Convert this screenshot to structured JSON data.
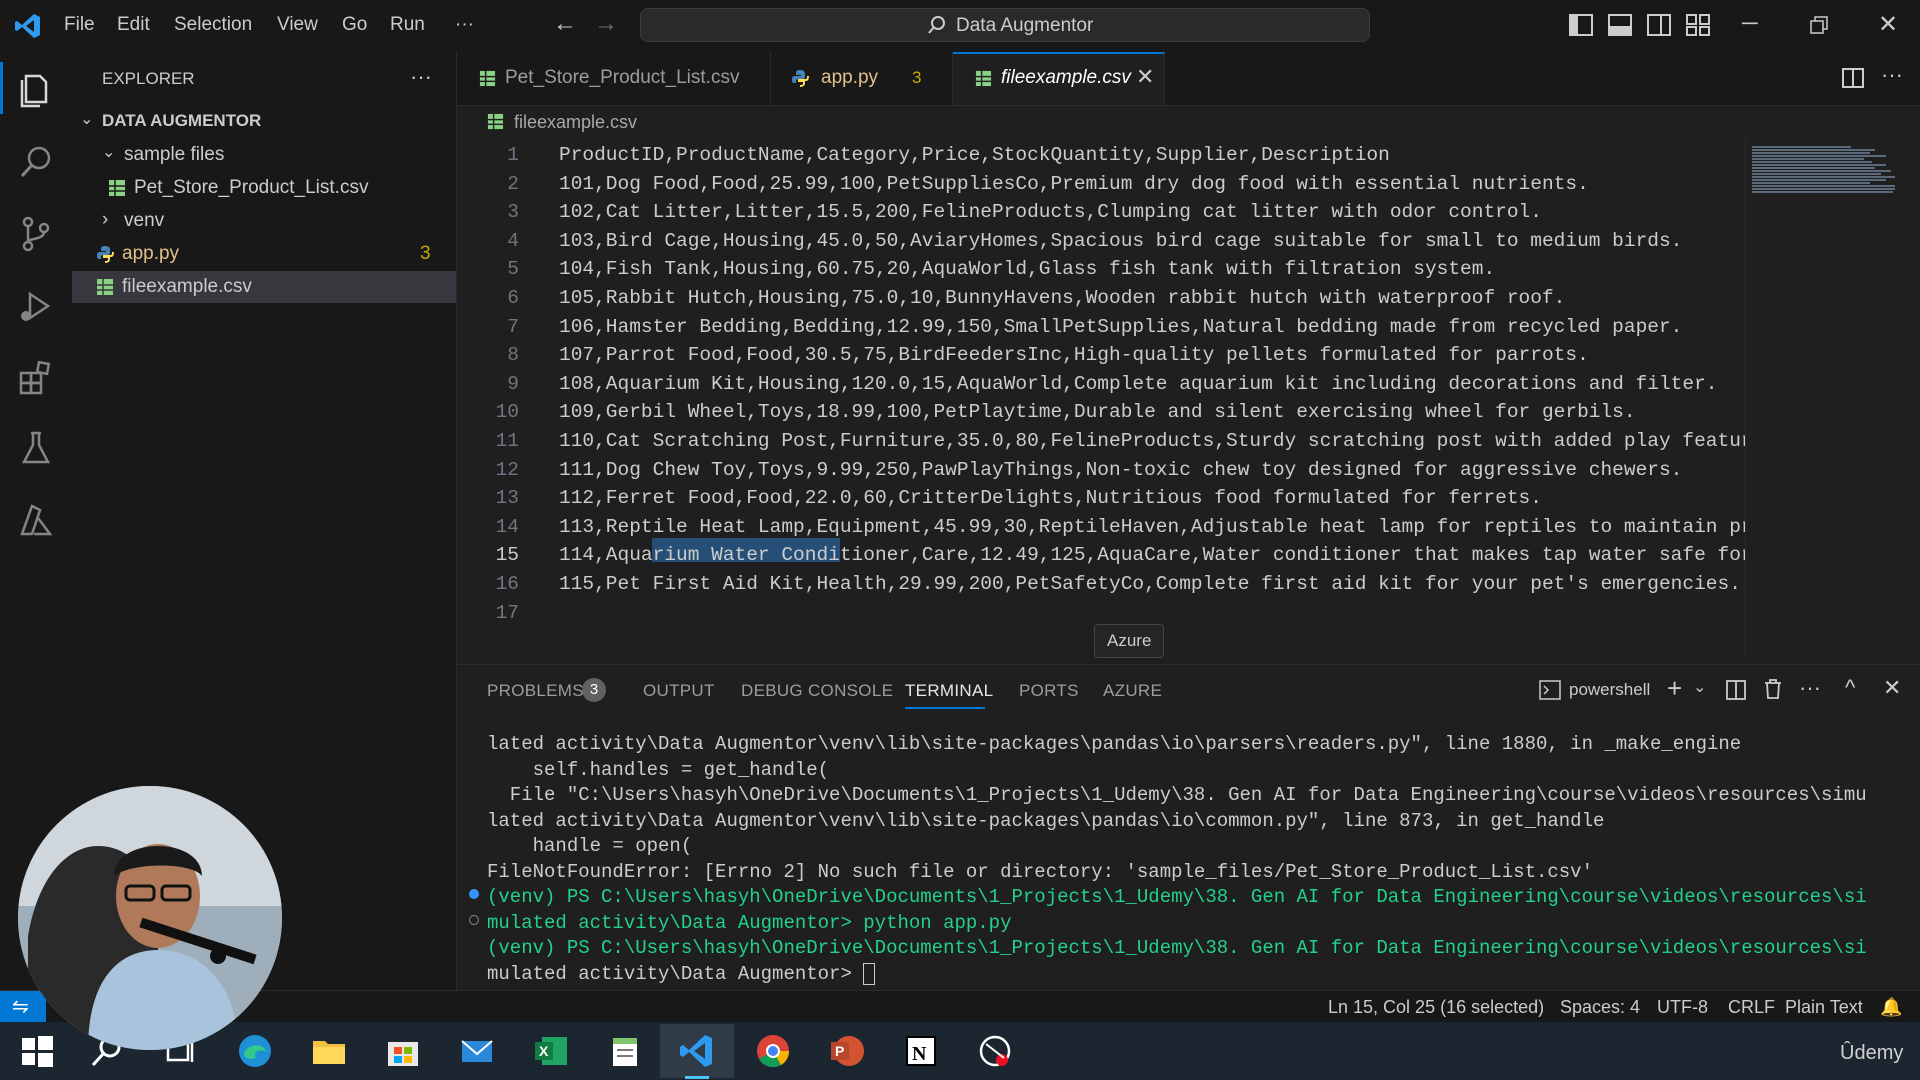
{
  "titlebar": {
    "menu": [
      "File",
      "Edit",
      "Selection",
      "View",
      "Go",
      "Run",
      "···"
    ],
    "search_text": "Data Augmentor"
  },
  "sidebar": {
    "header": "EXPLORER",
    "more": "···",
    "root": "DATA AUGMENTOR",
    "items": [
      {
        "label": "sample files",
        "type": "folder-open"
      },
      {
        "label": "Pet_Store_Product_List.csv",
        "type": "csv"
      },
      {
        "label": "venv",
        "type": "folder-closed"
      },
      {
        "label": "app.py",
        "type": "python",
        "badge": "3"
      },
      {
        "label": "fileexample.csv",
        "type": "csv",
        "selected": true
      }
    ]
  },
  "tabs": [
    {
      "label": "Pet_Store_Product_List.csv",
      "type": "csv"
    },
    {
      "label": "app.py",
      "type": "python",
      "badge": "3"
    },
    {
      "label": "fileexample.csv",
      "type": "csv",
      "active": true
    }
  ],
  "editor": {
    "breadcrumb": "fileexample.csv",
    "active_line": 15,
    "lines": [
      "ProductID,ProductName,Category,Price,StockQuantity,Supplier,Description",
      "101,Dog Food,Food,25.99,100,PetSuppliesCo,Premium dry dog food with essential nutrients.",
      "102,Cat Litter,Litter,15.5,200,FelineProducts,Clumping cat litter with odor control.",
      "103,Bird Cage,Housing,45.0,50,AviaryHomes,Spacious bird cage suitable for small to medium birds.",
      "104,Fish Tank,Housing,60.75,20,AquaWorld,Glass fish tank with filtration system.",
      "105,Rabbit Hutch,Housing,75.0,10,BunnyHavens,Wooden rabbit hutch with waterproof roof.",
      "106,Hamster Bedding,Bedding,12.99,150,SmallPetSupplies,Natural bedding made from recycled paper.",
      "107,Parrot Food,Food,30.5,75,BirdFeedersInc,High-quality pellets formulated for parrots.",
      "108,Aquarium Kit,Housing,120.0,15,AquaWorld,Complete aquarium kit including decorations and filter.",
      "109,Gerbil Wheel,Toys,18.99,100,PetPlaytime,Durable and silent exercising wheel for gerbils.",
      "110,Cat Scratching Post,Furniture,35.0,80,FelineProducts,Sturdy scratching post with added play featur",
      "111,Dog Chew Toy,Toys,9.99,250,PawPlayThings,Non-toxic chew toy designed for aggressive chewers.",
      "112,Ferret Food,Food,22.0,60,CritterDelights,Nutritious food formulated for ferrets.",
      "113,Reptile Heat Lamp,Equipment,45.99,30,ReptileHaven,Adjustable heat lamp for reptiles to maintain pr",
      "114,Aquarium Water Conditioner,Care,12.49,125,AquaCare,Water conditioner that makes tap water safe for",
      "115,Pet First Aid Kit,Health,29.99,200,PetSafetyCo,Complete first aid kit for your pet's emergencies.",
      ""
    ]
  },
  "tooltip": "Azure",
  "panel": {
    "tabs": [
      "PROBLEMS",
      "OUTPUT",
      "DEBUG CONSOLE",
      "TERMINAL",
      "PORTS",
      "AZURE"
    ],
    "problems_badge": "3",
    "active_tab": "TERMINAL",
    "shell": "powershell",
    "terminal_lines": [
      "lated activity\\Data Augmentor\\venv\\lib\\site-packages\\pandas\\io\\parsers\\readers.py\", line 1880, in _make_engine",
      "    self.handles = get_handle(",
      "  File \"C:\\Users\\hasyh\\OneDrive\\Documents\\1_Projects\\1_Udemy\\38. Gen AI for Data Engineering\\course\\videos\\resources\\simu",
      "lated activity\\Data Augmentor\\venv\\lib\\site-packages\\pandas\\io\\common.py\", line 873, in get_handle",
      "    handle = open(",
      "FileNotFoundError: [Errno 2] No such file or directory: 'sample_files/Pet_Store_Product_List.csv'",
      "(venv) PS C:\\Users\\hasyh\\OneDrive\\Documents\\1_Projects\\1_Udemy\\38. Gen AI for Data Engineering\\course\\videos\\resources\\si",
      "mulated activity\\Data Augmentor> python app.py",
      "(venv) PS C:\\Users\\hasyh\\OneDrive\\Documents\\1_Projects\\1_Udemy\\38. Gen AI for Data Engineering\\course\\videos\\resources\\si",
      "mulated activity\\Data Augmentor> "
    ]
  },
  "statusbar": {
    "position": "Ln 15, Col 25 (16 selected)",
    "spaces": "Spaces: 4",
    "encoding": "UTF-8",
    "eol": "CRLF",
    "language": "Plain Text"
  },
  "taskbar": {
    "watermark": "Ûdemy",
    "apps": [
      "windows-start",
      "search",
      "task-view",
      "edge",
      "file-explorer",
      "microsoft-store",
      "mail",
      "excel",
      "notepad",
      "vscode",
      "chrome",
      "powerpoint",
      "notion",
      "snipping-tool"
    ]
  },
  "colors": {
    "accent": "#0078d4",
    "csv_icon": "#89d185",
    "python_icon": "#4584b6",
    "warning_yellow": "#cca700",
    "selection": "#264f78"
  }
}
